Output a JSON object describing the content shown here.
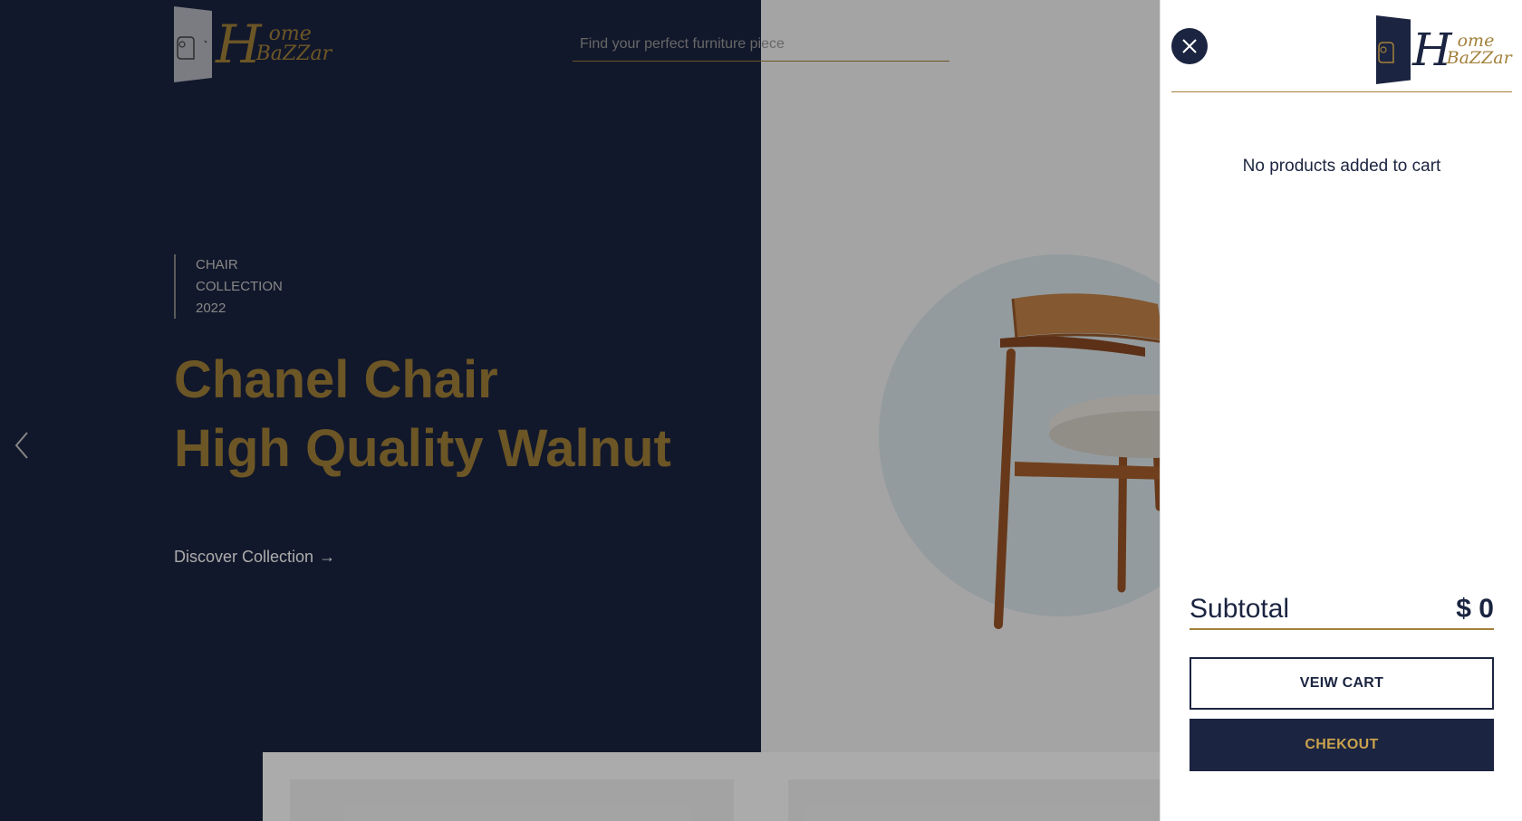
{
  "brand": {
    "line1": "ome",
    "line2": "BaZZar",
    "initial": "H"
  },
  "search": {
    "placeholder": "Find your perfect furniture piece"
  },
  "hero": {
    "collection": [
      "CHAIR",
      "COLLECTION",
      "2022"
    ],
    "headline_1": "Chanel Chair",
    "headline_2": "High Quality Walnut",
    "discover": "Discover Collection",
    "discover_arrow": "→"
  },
  "cart": {
    "empty_message": "No products added to cart",
    "subtotal_label": "Subtotal",
    "subtotal_value": "$ 0",
    "view_cart": "VEIW CART",
    "checkout": "CHEKOUT"
  },
  "icons": {
    "close": "close-icon",
    "prev": "chevron-left-icon",
    "logo": "armchair-door-icon"
  },
  "colors": {
    "navy": "#1b2440",
    "gold": "#a2803a",
    "gold_light": "#c9a24d"
  }
}
